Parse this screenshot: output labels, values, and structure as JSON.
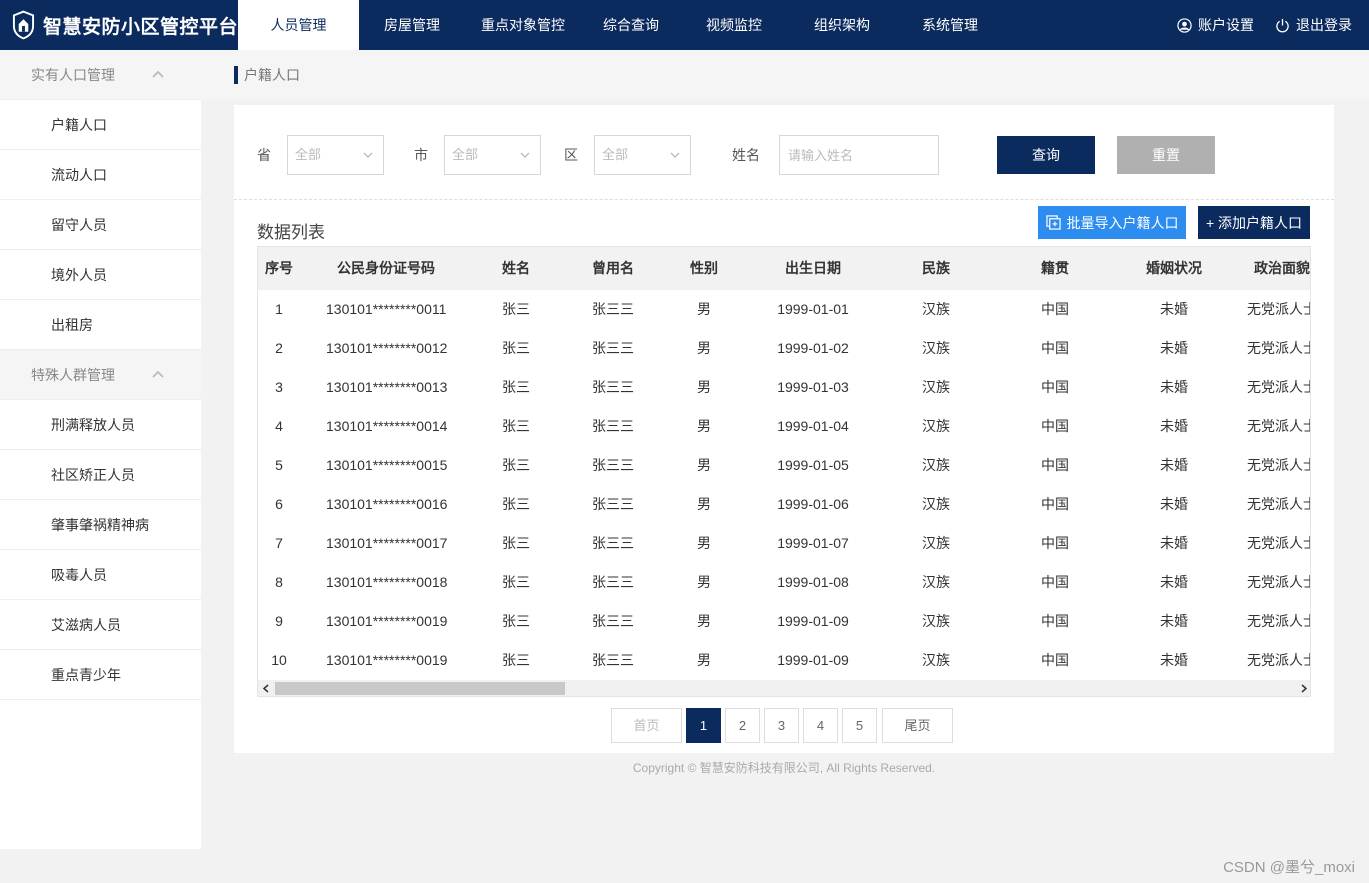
{
  "app": {
    "title": "智慧安防小区管控平台"
  },
  "nav": [
    {
      "label": "人员管理",
      "active": true
    },
    {
      "label": "房屋管理"
    },
    {
      "label": "重点对象管控"
    },
    {
      "label": "综合查询"
    },
    {
      "label": "视频监控"
    },
    {
      "label": "组织架构"
    },
    {
      "label": "系统管理"
    }
  ],
  "user_menu": {
    "account": "账户设置",
    "logout": "退出登录"
  },
  "sidebar": {
    "group1": "实有人口管理",
    "items1": [
      "户籍人口",
      "流动人口",
      "留守人员",
      "境外人员",
      "出租房"
    ],
    "group2": "特殊人群管理",
    "items2": [
      "刑满释放人员",
      "社区矫正人员",
      "肇事肇祸精神病",
      "吸毒人员",
      "艾滋病人员",
      "重点青少年"
    ]
  },
  "breadcrumb": "户籍人口",
  "filters": {
    "province_label": "省",
    "province_value": "全部",
    "city_label": "市",
    "city_value": "全部",
    "district_label": "区",
    "district_value": "全部",
    "name_label": "姓名",
    "name_placeholder": "请输入姓名",
    "query_label": "查询",
    "reset_label": "重置"
  },
  "list": {
    "title": "数据列表",
    "import_label": "批量导入户籍人口",
    "add_label": "+ 添加户籍人口"
  },
  "table": {
    "columns": [
      "序号",
      "公民身份证号码",
      "姓名",
      "曾用名",
      "性别",
      "出生日期",
      "民族",
      "籍贯",
      "婚姻状况",
      "政治面貌"
    ],
    "rows": [
      [
        "1",
        "130101********0011",
        "张三",
        "张三三",
        "男",
        "1999-01-01",
        "汉族",
        "中国",
        "未婚",
        "无党派人士"
      ],
      [
        "2",
        "130101********0012",
        "张三",
        "张三三",
        "男",
        "1999-01-02",
        "汉族",
        "中国",
        "未婚",
        "无党派人士"
      ],
      [
        "3",
        "130101********0013",
        "张三",
        "张三三",
        "男",
        "1999-01-03",
        "汉族",
        "中国",
        "未婚",
        "无党派人士"
      ],
      [
        "4",
        "130101********0014",
        "张三",
        "张三三",
        "男",
        "1999-01-04",
        "汉族",
        "中国",
        "未婚",
        "无党派人士"
      ],
      [
        "5",
        "130101********0015",
        "张三",
        "张三三",
        "男",
        "1999-01-05",
        "汉族",
        "中国",
        "未婚",
        "无党派人士"
      ],
      [
        "6",
        "130101********0016",
        "张三",
        "张三三",
        "男",
        "1999-01-06",
        "汉族",
        "中国",
        "未婚",
        "无党派人士"
      ],
      [
        "7",
        "130101********0017",
        "张三",
        "张三三",
        "男",
        "1999-01-07",
        "汉族",
        "中国",
        "未婚",
        "无党派人士"
      ],
      [
        "8",
        "130101********0018",
        "张三",
        "张三三",
        "男",
        "1999-01-08",
        "汉族",
        "中国",
        "未婚",
        "无党派人士"
      ],
      [
        "9",
        "130101********0019",
        "张三",
        "张三三",
        "男",
        "1999-01-09",
        "汉族",
        "中国",
        "未婚",
        "无党派人士"
      ],
      [
        "10",
        "130101********0019",
        "张三",
        "张三三",
        "男",
        "1999-01-09",
        "汉族",
        "中国",
        "未婚",
        "无党派人士"
      ]
    ]
  },
  "pagination": {
    "first": "首页",
    "pages": [
      "1",
      "2",
      "3",
      "4",
      "5"
    ],
    "current": "1",
    "last": "尾页"
  },
  "copyright": "Copyright © 智慧安防科技有限公司, All Rights Reserved.",
  "watermark": "CSDN @墨兮_moxi",
  "colors": {
    "primary": "#0b2b5e",
    "accent": "#2d8cf0",
    "reset": "#b0b0b0"
  },
  "icons": {
    "logo": "shield-house-icon",
    "account": "user-circle-icon",
    "logout": "power-icon",
    "import": "import-icon"
  }
}
